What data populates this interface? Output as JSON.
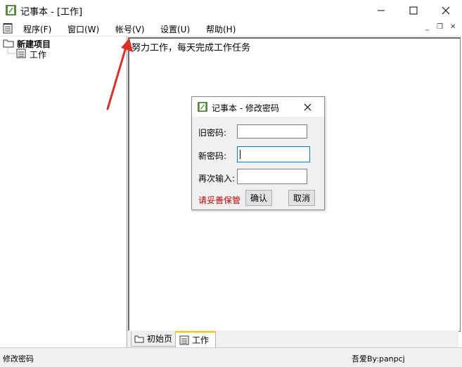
{
  "window": {
    "title": "记事本 - [工作]",
    "minimize_glyph": "—",
    "maximize_glyph": "☐",
    "close_glyph": "✕"
  },
  "menu": {
    "items": [
      {
        "label": "程序(F)"
      },
      {
        "label": "窗口(W)"
      },
      {
        "label": "帐号(V)"
      },
      {
        "label": "设置(U)"
      },
      {
        "label": "帮助(H)"
      }
    ],
    "mdi_minimize": "_",
    "mdi_restore": "❐",
    "mdi_close": "✕"
  },
  "tree": {
    "root_label": "新建项目",
    "child_label": "工作"
  },
  "editor": {
    "content": "努力工作，每天完成工作任务"
  },
  "tabs": [
    {
      "label": "初始页"
    },
    {
      "label": "工作"
    }
  ],
  "status": {
    "left": "修改密码",
    "right": "吾爱By:panpcj"
  },
  "dialog": {
    "title": "记事本 - 修改密码",
    "old_password_label": "旧密码:",
    "old_password_value": "",
    "new_password_label": "新密码:",
    "new_password_value": "",
    "confirm_label": "再次输入:",
    "confirm_value": "",
    "hint": "请妥善保管",
    "ok_label": "确认",
    "cancel_label": "取消"
  },
  "colors": {
    "hint_red": "#c00000",
    "arrow_red": "#d9302c",
    "input_focus_blue": "#0078d7"
  }
}
